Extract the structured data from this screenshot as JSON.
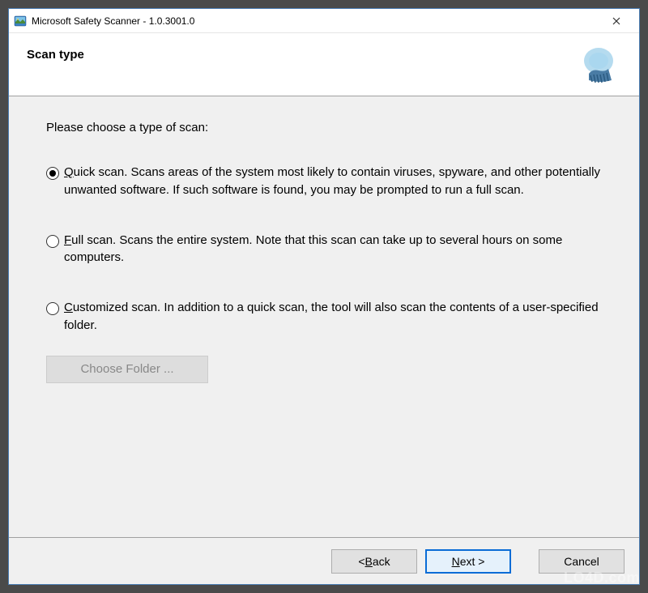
{
  "titlebar": {
    "text": "Microsoft Safety Scanner - 1.0.3001.0"
  },
  "header": {
    "title": "Scan type"
  },
  "content": {
    "prompt": "Please choose a type of scan:",
    "options": [
      {
        "accel": "Q",
        "rest": "uick scan. Scans areas of the system most likely to contain viruses, spyware, and other potentially unwanted software. If such software is found, you may be prompted to run a full scan.",
        "selected": true
      },
      {
        "accel": "F",
        "rest": "ull scan. Scans the entire system. Note that this scan can take up to several hours on some computers.",
        "selected": false
      },
      {
        "accel": "C",
        "rest": "ustomized scan. In addition to a quick scan, the tool will also scan the contents of a user-specified folder.",
        "selected": false
      }
    ],
    "choose_folder": "Choose Folder ..."
  },
  "footer": {
    "back_prefix": "< ",
    "back_accel": "B",
    "back_rest": "ack",
    "next_accel": "N",
    "next_rest": "ext >",
    "cancel": "Cancel"
  },
  "watermark": "LO4D.com"
}
